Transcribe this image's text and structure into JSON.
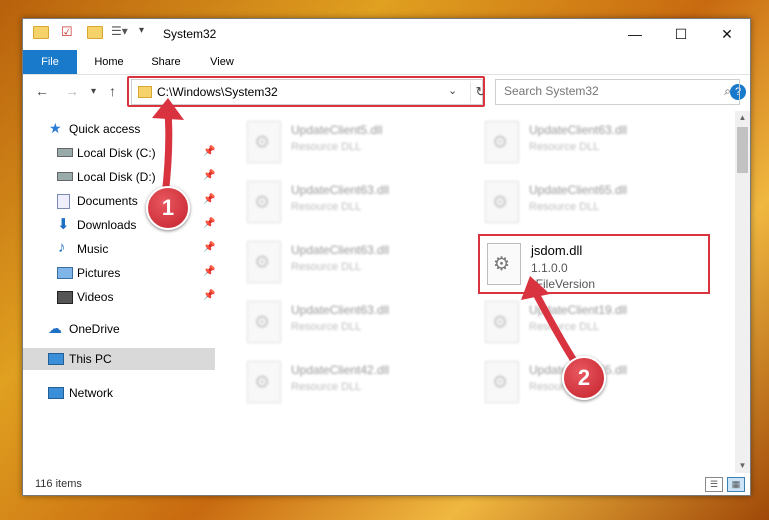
{
  "window": {
    "title": "System32",
    "minimize": "—",
    "maximize": "☐",
    "close": "✕"
  },
  "ribbon": {
    "tabs": [
      "File",
      "Home",
      "Share",
      "View"
    ],
    "help": "?"
  },
  "navigation": {
    "address": "C:\\Windows\\System32",
    "search_placeholder": "Search System32"
  },
  "sidebar": {
    "items": [
      {
        "label": "Quick access"
      },
      {
        "label": "Local Disk (C:)"
      },
      {
        "label": "Local Disk (D:)"
      },
      {
        "label": "Documents"
      },
      {
        "label": "Downloads"
      },
      {
        "label": "Music"
      },
      {
        "label": "Pictures"
      },
      {
        "label": "Videos"
      },
      {
        "label": "OneDrive"
      },
      {
        "label": "This PC"
      },
      {
        "label": "Network"
      }
    ]
  },
  "files": [
    {
      "name": "UpdateClient5.dll",
      "type": "Resource DLL"
    },
    {
      "name": "UpdateClient63.dll",
      "type": "Resource DLL"
    },
    {
      "name": "UpdateClient63.dll",
      "type": "Resource DLL"
    },
    {
      "name": "UpdateClient65.dll",
      "type": "Resource DLL"
    },
    {
      "name": "UpdateClient63.dll",
      "type": "Resource DLL"
    },
    {
      "name": "UpdateClient63.dll",
      "type": "Resource DLL"
    },
    {
      "name": "UpdateClient19.dll",
      "type": "Resource DLL"
    },
    {
      "name": "UpdateClient42.dll",
      "type": "Resource DLL"
    },
    {
      "name": "UpdateClient65.dll",
      "type": "Resource DLL"
    }
  ],
  "focused_file": {
    "name": "jsdom.dll",
    "version": "1.1.0.0",
    "type": "*FileVersion"
  },
  "status": {
    "items_count": "116 items"
  },
  "annotations": {
    "step1": "1",
    "step2": "2",
    "highlight_color": "#d9333f"
  }
}
